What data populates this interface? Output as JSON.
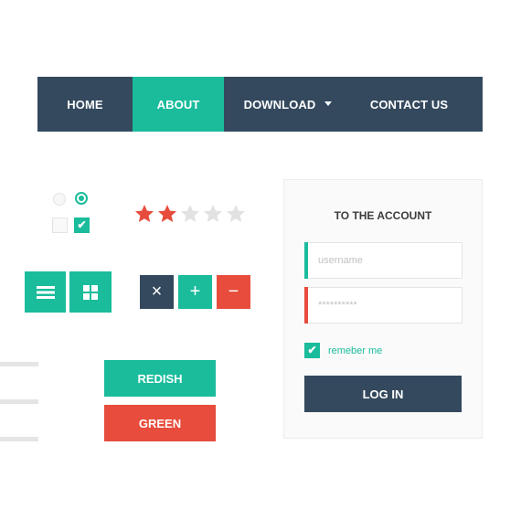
{
  "colors": {
    "navy": "#34495e",
    "teal": "#1abc9c",
    "red": "#e74c3c",
    "inactive_star": "#e2e2e2"
  },
  "nav": {
    "items": [
      {
        "label": "HOME",
        "active": false
      },
      {
        "label": "ABOUT",
        "active": true
      },
      {
        "label": "DOWNLOAD",
        "active": false,
        "has_dropdown": true,
        "icon": "caret-down-icon"
      },
      {
        "label": "CONTACT US",
        "active": false
      }
    ]
  },
  "controls": {
    "radios": [
      {
        "checked": false
      },
      {
        "checked": true
      }
    ],
    "checkboxes": [
      {
        "checked": false
      },
      {
        "checked": true,
        "icon": "check-icon",
        "glyph": "✔"
      }
    ]
  },
  "rating": {
    "value": 2,
    "max": 5
  },
  "icon_buttons": [
    {
      "icon": "menu-icon"
    },
    {
      "icon": "grid-icon"
    }
  ],
  "small_buttons": [
    {
      "icon": "close-icon",
      "glyph": "×",
      "color": "#34495e"
    },
    {
      "icon": "plus-icon",
      "glyph": "+",
      "color": "#1abc9c"
    },
    {
      "icon": "minus-icon",
      "glyph": "−",
      "color": "#e74c3c"
    }
  ],
  "color_buttons": [
    {
      "label": "REDISH",
      "color": "#1abc9c"
    },
    {
      "label": "GREEN",
      "color": "#e74c3c"
    }
  ],
  "login": {
    "title": "TO THE ACCOUNT",
    "username_placeholder": "username",
    "password_placeholder": "**********",
    "remember_label": "remeber me",
    "remember_checked": true,
    "check_glyph": "✔",
    "submit_label": "LOG IN"
  }
}
